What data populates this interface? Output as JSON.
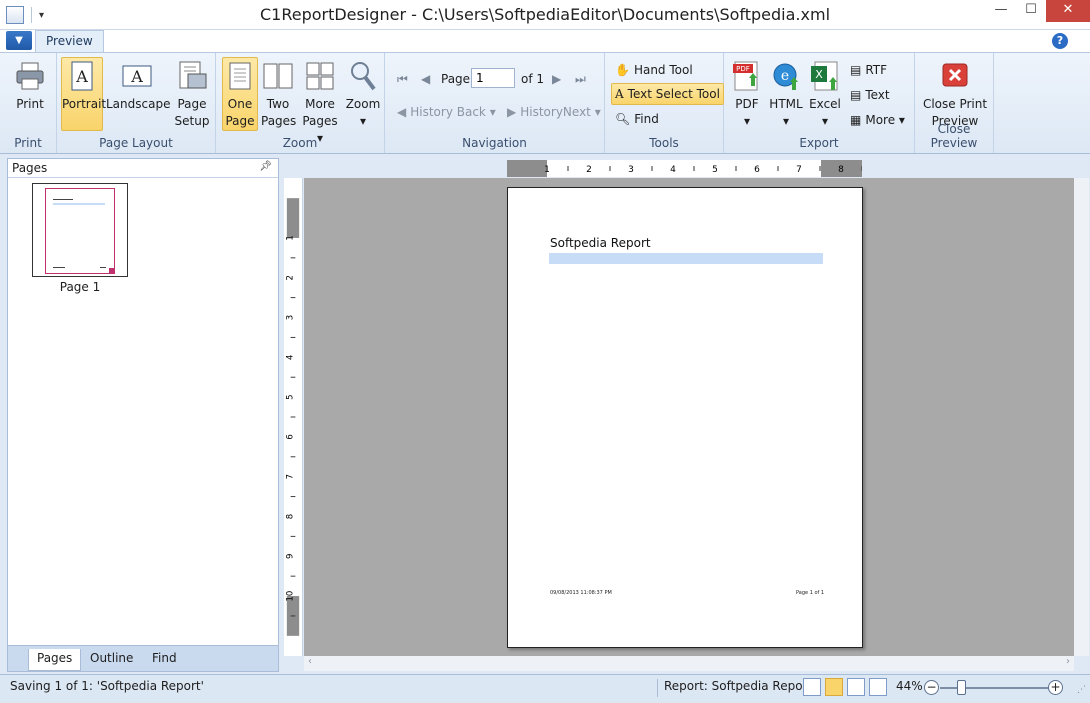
{
  "window": {
    "title": "C1ReportDesigner - C:\\Users\\SoftpediaEditor\\Documents\\Softpedia.xml",
    "minimize": "—",
    "maximize": "☐",
    "close": "✕"
  },
  "tabs": {
    "preview": "Preview",
    "help": "?"
  },
  "ribbon": {
    "print": {
      "print_label": "Print",
      "group": "Print"
    },
    "layout": {
      "portrait": "Portrait",
      "landscape": "Landscape",
      "page_setup_1": "Page",
      "page_setup_2": "Setup",
      "group": "Page Layout"
    },
    "zoom": {
      "one_page_1": "One",
      "one_page_2": "Page",
      "two_pages_1": "Two",
      "two_pages_2": "Pages",
      "more_pages_1": "More",
      "more_pages_2": "Pages ▾",
      "zoom_label": "Zoom",
      "zoom_drop": "▾",
      "group": "Zoom"
    },
    "navigation": {
      "page_label": "Page",
      "page_value": "1",
      "of_label": "of 1",
      "history_back": "History Back ▾",
      "history_next": "HistoryNext ▾",
      "group": "Navigation"
    },
    "tools": {
      "hand": "Hand Tool",
      "text_select": "Text Select Tool",
      "find": "Find",
      "group": "Tools"
    },
    "export": {
      "pdf": "PDF",
      "html": "HTML",
      "excel": "Excel",
      "rtf": "RTF",
      "text": "Text",
      "more": "More ▾",
      "drop": "▾",
      "group": "Export"
    },
    "close": {
      "close_1": "Close Print",
      "close_2": "Preview",
      "group": "Close Preview"
    }
  },
  "pages_pane": {
    "header": "Pages",
    "thumb_label": "Page 1",
    "tabs": [
      "Pages",
      "Outline",
      "Find"
    ]
  },
  "ruler": {
    "h_ticks": [
      "1",
      "2",
      "3",
      "4",
      "5",
      "6",
      "7",
      "8"
    ],
    "v_ticks": [
      "1",
      "2",
      "3",
      "4",
      "5",
      "6",
      "7",
      "8",
      "9",
      "10"
    ]
  },
  "report": {
    "title": "Softpedia Report",
    "footer_date": "09/08/2013 11:08:37 PM",
    "footer_page": "Page 1 of 1"
  },
  "status": {
    "message": "Saving 1 of 1: 'Softpedia Report'",
    "report": "Report: Softpedia Report",
    "zoom": "44%",
    "zoom_level_percent": 44
  },
  "colors": {
    "accent": "#f9d46b",
    "ribbon": "#dde8f5",
    "close": "#c7453c",
    "preview_bg": "#a9a9a9"
  }
}
